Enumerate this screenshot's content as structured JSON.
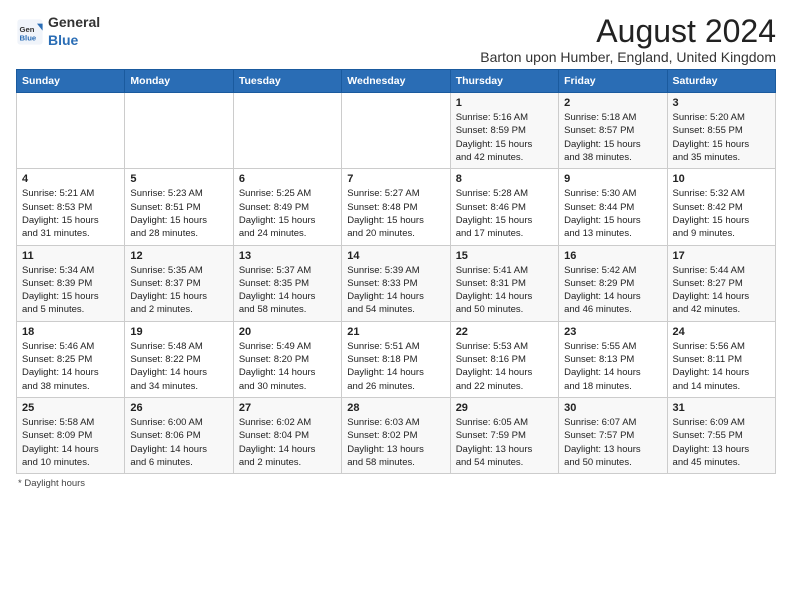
{
  "header": {
    "logo_general": "General",
    "logo_blue": "Blue",
    "main_title": "August 2024",
    "subtitle": "Barton upon Humber, England, United Kingdom"
  },
  "days_of_week": [
    "Sunday",
    "Monday",
    "Tuesday",
    "Wednesday",
    "Thursday",
    "Friday",
    "Saturday"
  ],
  "weeks": [
    [
      {
        "num": "",
        "info": ""
      },
      {
        "num": "",
        "info": ""
      },
      {
        "num": "",
        "info": ""
      },
      {
        "num": "",
        "info": ""
      },
      {
        "num": "1",
        "info": "Sunrise: 5:16 AM\nSunset: 8:59 PM\nDaylight: 15 hours\nand 42 minutes."
      },
      {
        "num": "2",
        "info": "Sunrise: 5:18 AM\nSunset: 8:57 PM\nDaylight: 15 hours\nand 38 minutes."
      },
      {
        "num": "3",
        "info": "Sunrise: 5:20 AM\nSunset: 8:55 PM\nDaylight: 15 hours\nand 35 minutes."
      }
    ],
    [
      {
        "num": "4",
        "info": "Sunrise: 5:21 AM\nSunset: 8:53 PM\nDaylight: 15 hours\nand 31 minutes."
      },
      {
        "num": "5",
        "info": "Sunrise: 5:23 AM\nSunset: 8:51 PM\nDaylight: 15 hours\nand 28 minutes."
      },
      {
        "num": "6",
        "info": "Sunrise: 5:25 AM\nSunset: 8:49 PM\nDaylight: 15 hours\nand 24 minutes."
      },
      {
        "num": "7",
        "info": "Sunrise: 5:27 AM\nSunset: 8:48 PM\nDaylight: 15 hours\nand 20 minutes."
      },
      {
        "num": "8",
        "info": "Sunrise: 5:28 AM\nSunset: 8:46 PM\nDaylight: 15 hours\nand 17 minutes."
      },
      {
        "num": "9",
        "info": "Sunrise: 5:30 AM\nSunset: 8:44 PM\nDaylight: 15 hours\nand 13 minutes."
      },
      {
        "num": "10",
        "info": "Sunrise: 5:32 AM\nSunset: 8:42 PM\nDaylight: 15 hours\nand 9 minutes."
      }
    ],
    [
      {
        "num": "11",
        "info": "Sunrise: 5:34 AM\nSunset: 8:39 PM\nDaylight: 15 hours\nand 5 minutes."
      },
      {
        "num": "12",
        "info": "Sunrise: 5:35 AM\nSunset: 8:37 PM\nDaylight: 15 hours\nand 2 minutes."
      },
      {
        "num": "13",
        "info": "Sunrise: 5:37 AM\nSunset: 8:35 PM\nDaylight: 14 hours\nand 58 minutes."
      },
      {
        "num": "14",
        "info": "Sunrise: 5:39 AM\nSunset: 8:33 PM\nDaylight: 14 hours\nand 54 minutes."
      },
      {
        "num": "15",
        "info": "Sunrise: 5:41 AM\nSunset: 8:31 PM\nDaylight: 14 hours\nand 50 minutes."
      },
      {
        "num": "16",
        "info": "Sunrise: 5:42 AM\nSunset: 8:29 PM\nDaylight: 14 hours\nand 46 minutes."
      },
      {
        "num": "17",
        "info": "Sunrise: 5:44 AM\nSunset: 8:27 PM\nDaylight: 14 hours\nand 42 minutes."
      }
    ],
    [
      {
        "num": "18",
        "info": "Sunrise: 5:46 AM\nSunset: 8:25 PM\nDaylight: 14 hours\nand 38 minutes."
      },
      {
        "num": "19",
        "info": "Sunrise: 5:48 AM\nSunset: 8:22 PM\nDaylight: 14 hours\nand 34 minutes."
      },
      {
        "num": "20",
        "info": "Sunrise: 5:49 AM\nSunset: 8:20 PM\nDaylight: 14 hours\nand 30 minutes."
      },
      {
        "num": "21",
        "info": "Sunrise: 5:51 AM\nSunset: 8:18 PM\nDaylight: 14 hours\nand 26 minutes."
      },
      {
        "num": "22",
        "info": "Sunrise: 5:53 AM\nSunset: 8:16 PM\nDaylight: 14 hours\nand 22 minutes."
      },
      {
        "num": "23",
        "info": "Sunrise: 5:55 AM\nSunset: 8:13 PM\nDaylight: 14 hours\nand 18 minutes."
      },
      {
        "num": "24",
        "info": "Sunrise: 5:56 AM\nSunset: 8:11 PM\nDaylight: 14 hours\nand 14 minutes."
      }
    ],
    [
      {
        "num": "25",
        "info": "Sunrise: 5:58 AM\nSunset: 8:09 PM\nDaylight: 14 hours\nand 10 minutes."
      },
      {
        "num": "26",
        "info": "Sunrise: 6:00 AM\nSunset: 8:06 PM\nDaylight: 14 hours\nand 6 minutes."
      },
      {
        "num": "27",
        "info": "Sunrise: 6:02 AM\nSunset: 8:04 PM\nDaylight: 14 hours\nand 2 minutes."
      },
      {
        "num": "28",
        "info": "Sunrise: 6:03 AM\nSunset: 8:02 PM\nDaylight: 13 hours\nand 58 minutes."
      },
      {
        "num": "29",
        "info": "Sunrise: 6:05 AM\nSunset: 7:59 PM\nDaylight: 13 hours\nand 54 minutes."
      },
      {
        "num": "30",
        "info": "Sunrise: 6:07 AM\nSunset: 7:57 PM\nDaylight: 13 hours\nand 50 minutes."
      },
      {
        "num": "31",
        "info": "Sunrise: 6:09 AM\nSunset: 7:55 PM\nDaylight: 13 hours\nand 45 minutes."
      }
    ]
  ],
  "footer": {
    "note": "* Daylight hours"
  }
}
